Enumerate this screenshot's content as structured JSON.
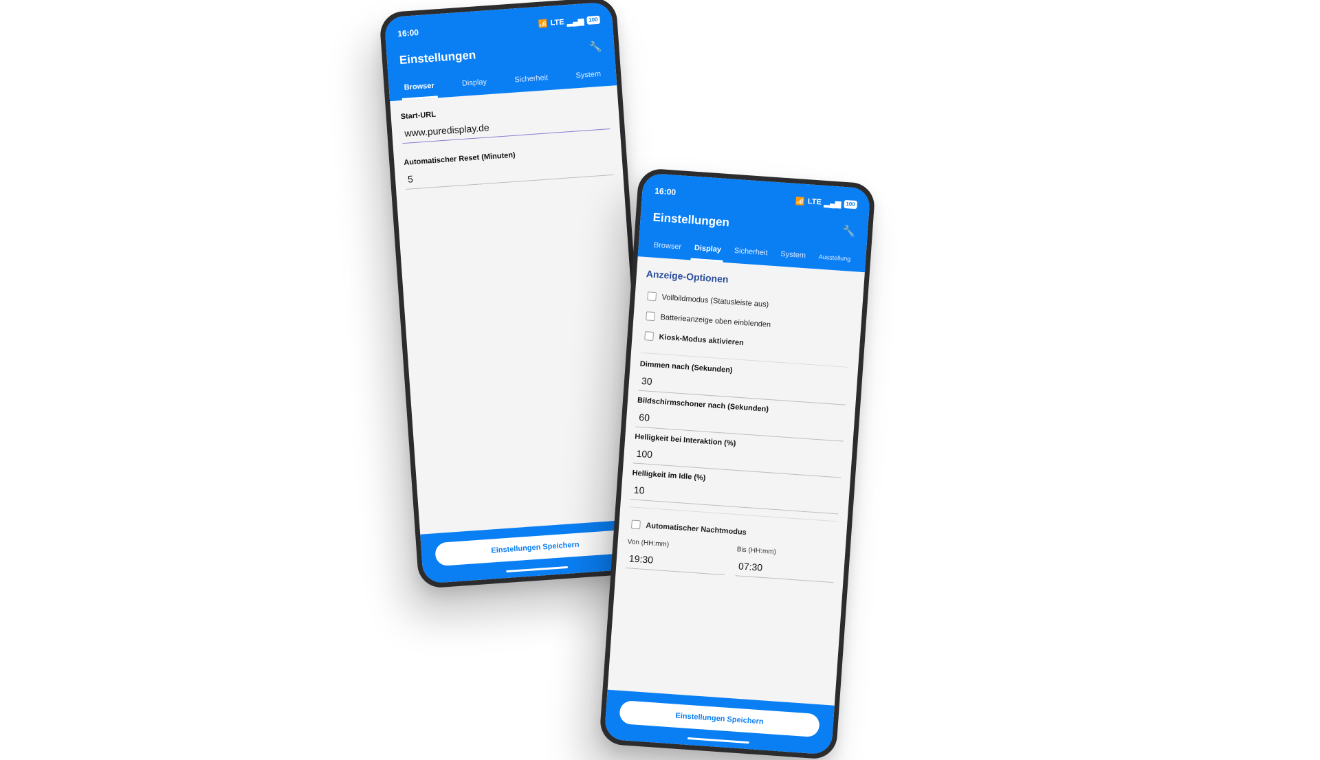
{
  "phone_a": {
    "status": {
      "time": "16:00",
      "network": "LTE",
      "battery": "100"
    },
    "title": "Einstellungen",
    "tabs": [
      {
        "label": "Browser",
        "active": true
      },
      {
        "label": "Display"
      },
      {
        "label": "Sicherheit"
      },
      {
        "label": "System"
      }
    ],
    "fields": {
      "start_url_label": "Start-URL",
      "start_url_value": "www.puredisplay.de",
      "reset_label": "Automatischer Reset (Minuten)",
      "reset_value": "5"
    },
    "save_label": "Einstellungen Speichern"
  },
  "phone_b": {
    "status": {
      "time": "16:00",
      "network": "LTE",
      "battery": "100"
    },
    "title": "Einstellungen",
    "tabs": [
      {
        "label": "Browser"
      },
      {
        "label": "Display",
        "active": true
      },
      {
        "label": "Sicherheit"
      },
      {
        "label": "System"
      },
      {
        "label": "Ausstellung"
      }
    ],
    "section_title": "Anzeige-Optionen",
    "checkboxes": {
      "fullscreen": "Vollbildmodus (Statusleiste aus)",
      "battery": "Batterieanzeige oben einblenden",
      "kiosk": "Kiosk-Modus aktivieren"
    },
    "fields": {
      "dim_label": "Dimmen nach (Sekunden)",
      "dim_value": "30",
      "screensaver_label": "Bildschirmschoner nach (Sekunden)",
      "screensaver_value": "60",
      "brightness_interaction_label": "Helligkeit bei Interaktion (%)",
      "brightness_interaction_value": "100",
      "brightness_idle_label": "Helligkeit im Idle (%)",
      "brightness_idle_value": "10"
    },
    "night_mode": {
      "label": "Automatischer Nachtmodus",
      "from_label": "Von (HH:mm)",
      "from_value": "19:30",
      "to_label": "Bis (HH:mm)",
      "to_value": "07:30"
    },
    "save_label": "Einstellungen Speichern"
  },
  "colors": {
    "accent": "#0a7ff4",
    "section_title": "#2a4d9b",
    "background": "#f4f4f4"
  },
  "icons": {
    "wrench": "wrench-icon",
    "wifi": "wifi-icon",
    "signal": "signal-icon"
  }
}
